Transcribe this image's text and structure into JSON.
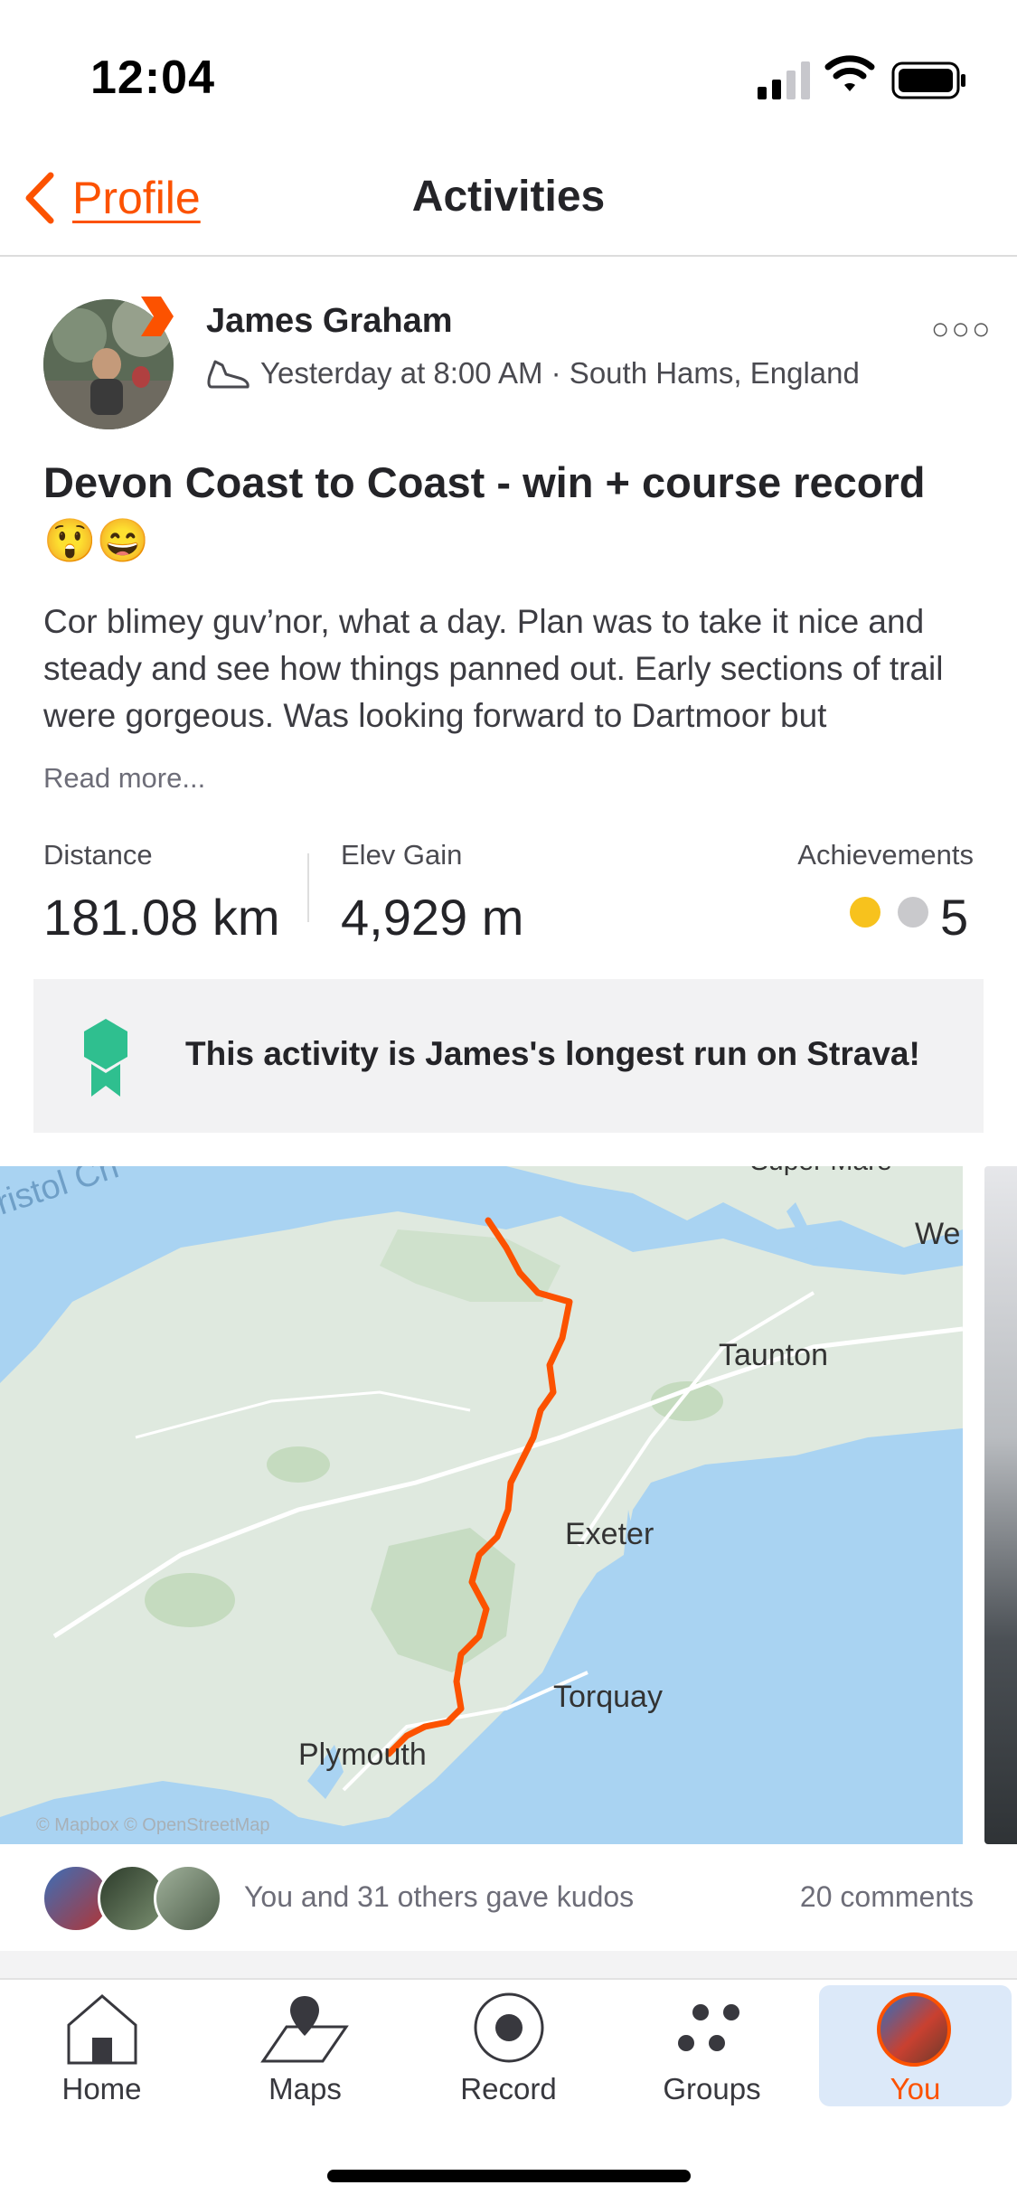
{
  "status_bar": {
    "time": "12:04"
  },
  "nav": {
    "back_label": "Profile",
    "title": "Activities"
  },
  "activity": {
    "athlete_name": "James Graham",
    "meta": "Yesterday at 8:00 AM · South Hams, England",
    "title": "Devon Coast to Coast - win + course record 😲😄",
    "description": "Cor blimey guv’nor, what a day. Plan was to take it nice and steady and see how things panned out. Early sections of trail were gorgeous. Was looking forward to Dartmoor but",
    "read_more": "Read more...",
    "stats": {
      "distance_label": "Distance",
      "distance_value": "181.08 km",
      "elev_label": "Elev Gain",
      "elev_value": "4,929 m",
      "achievements_label": "Achievements",
      "achievements_count": "5"
    },
    "banner_text": "This activity is James's longest run on Strava!",
    "map": {
      "labels": {
        "bristol": "ristol Ch",
        "super_mare": "Super Mare",
        "we": "We",
        "taunton": "Taunton",
        "exeter": "Exeter",
        "torquay": "Torquay",
        "plymouth": "Plymouth"
      },
      "attribution": "© Mapbox © OpenStreetMap",
      "route_color": "#fc5200"
    },
    "kudos_text": "You and 31 others gave kudos",
    "comments_text": "20 comments"
  },
  "tabs": [
    {
      "label": "Home",
      "icon": "home-icon"
    },
    {
      "label": "Maps",
      "icon": "map-pin-icon"
    },
    {
      "label": "Record",
      "icon": "record-icon"
    },
    {
      "label": "Groups",
      "icon": "groups-icon"
    },
    {
      "label": "You",
      "icon": "avatar"
    }
  ],
  "colors": {
    "accent": "#fc5200",
    "active_tab_bg": "#dce9f9",
    "banner_badge": "#2fbf8f"
  }
}
